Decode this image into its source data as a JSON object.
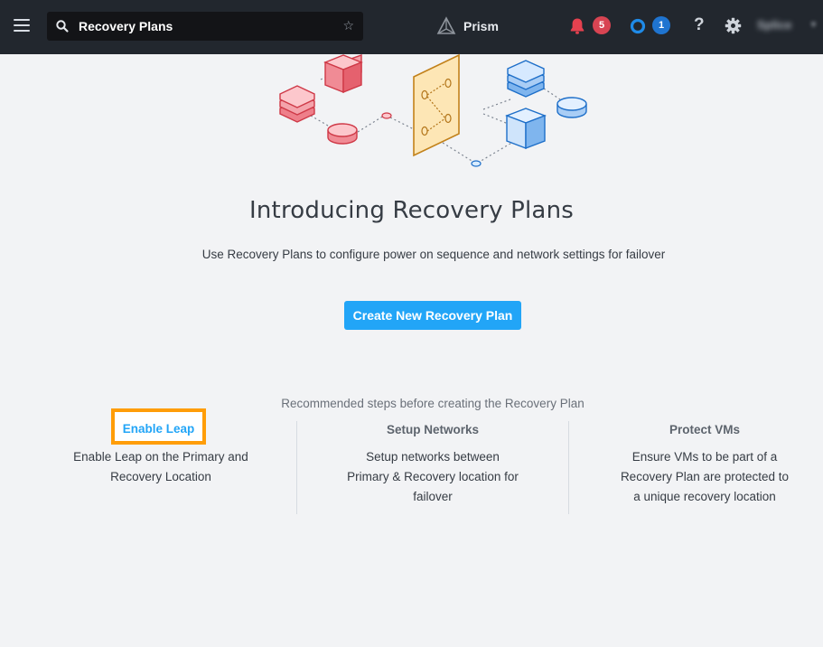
{
  "header": {
    "search_value": "Recovery Plans",
    "brand_name": "Prism",
    "alerts_count": "5",
    "tasks_count": "1",
    "help_glyph": "?",
    "user_name": "Splice",
    "icons": [
      "menu-icon",
      "search-icon",
      "star-icon",
      "prism-logo-icon",
      "bell-icon",
      "tasks-circle-icon",
      "help-icon",
      "gear-icon",
      "chevron-down-icon"
    ],
    "colors": {
      "bar": "#22272e",
      "alert_badge": "#d84452",
      "task_badge": "#1f74d0"
    }
  },
  "main": {
    "title": "Introducing Recovery Plans",
    "subtitle": "Use Recovery Plans to configure power on sequence and network settings for failover",
    "create_button": "Create New Recovery Plan",
    "steps_heading": "Recommended steps before creating the Recovery Plan",
    "steps": [
      {
        "title": "Enable Leap",
        "desc_line1": "Enable Leap on the Primary and",
        "desc_line2": "Recovery Location",
        "desc_line3": ""
      },
      {
        "title": "Setup Networks",
        "desc_line1": "Setup networks between",
        "desc_line2": "Primary & Recovery location for",
        "desc_line3": "failover"
      },
      {
        "title": "Protect VMs",
        "desc_line1": "Ensure VMs to be part of a",
        "desc_line2": "Recovery Plan are protected to",
        "desc_line3": "a unique recovery location"
      }
    ],
    "colors": {
      "accent": "#22a5f7",
      "highlight_border": "#ff9d08"
    }
  }
}
